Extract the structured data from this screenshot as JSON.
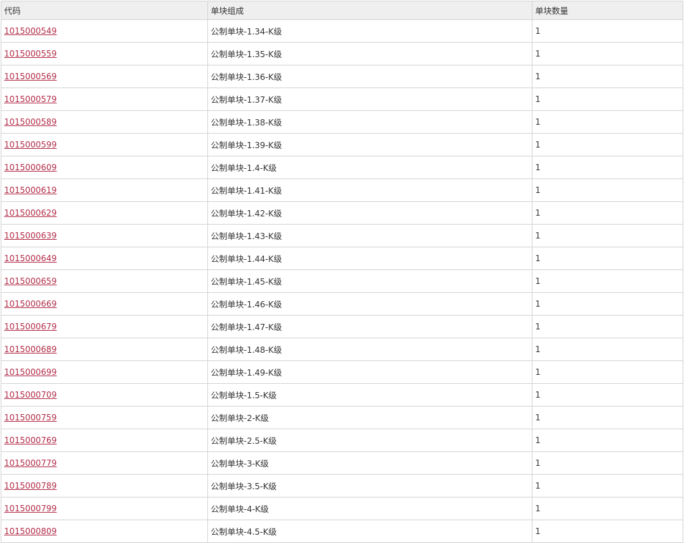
{
  "table": {
    "headers": [
      "代码",
      "单块组成",
      "单块数量"
    ],
    "rows": [
      {
        "code": "1015000549",
        "composition": "公制单块-1.34-K级",
        "quantity": "1"
      },
      {
        "code": "1015000559",
        "composition": "公制单块-1.35-K级",
        "quantity": "1"
      },
      {
        "code": "1015000569",
        "composition": "公制单块-1.36-K级",
        "quantity": "1"
      },
      {
        "code": "1015000579",
        "composition": "公制单块-1.37-K级",
        "quantity": "1"
      },
      {
        "code": "1015000589",
        "composition": "公制单块-1.38-K级",
        "quantity": "1"
      },
      {
        "code": "1015000599",
        "composition": "公制单块-1.39-K级",
        "quantity": "1"
      },
      {
        "code": "1015000609",
        "composition": "公制单块-1.4-K级",
        "quantity": "1"
      },
      {
        "code": "1015000619",
        "composition": "公制单块-1.41-K级",
        "quantity": "1"
      },
      {
        "code": "1015000629",
        "composition": "公制单块-1.42-K级",
        "quantity": "1"
      },
      {
        "code": "1015000639",
        "composition": "公制单块-1.43-K级",
        "quantity": "1"
      },
      {
        "code": "1015000649",
        "composition": "公制单块-1.44-K级",
        "quantity": "1"
      },
      {
        "code": "1015000659",
        "composition": "公制单块-1.45-K级",
        "quantity": "1"
      },
      {
        "code": "1015000669",
        "composition": "公制单块-1.46-K级",
        "quantity": "1"
      },
      {
        "code": "1015000679",
        "composition": "公制单块-1.47-K级",
        "quantity": "1"
      },
      {
        "code": "1015000689",
        "composition": "公制单块-1.48-K级",
        "quantity": "1"
      },
      {
        "code": "1015000699",
        "composition": "公制单块-1.49-K级",
        "quantity": "1"
      },
      {
        "code": "1015000709",
        "composition": "公制单块-1.5-K级",
        "quantity": "1"
      },
      {
        "code": "1015000759",
        "composition": "公制单块-2-K级",
        "quantity": "1"
      },
      {
        "code": "1015000769",
        "composition": "公制单块-2.5-K级",
        "quantity": "1"
      },
      {
        "code": "1015000779",
        "composition": "公制单块-3-K级",
        "quantity": "1"
      },
      {
        "code": "1015000789",
        "composition": "公制单块-3.5-K级",
        "quantity": "1"
      },
      {
        "code": "1015000799",
        "composition": "公制单块-4-K级",
        "quantity": "1"
      },
      {
        "code": "1015000809",
        "composition": "公制单块-4.5-K级",
        "quantity": "1"
      }
    ]
  },
  "colors": {
    "link": "#b22c47",
    "header_bg": "#efefef",
    "border": "#d4d4d4",
    "text": "#333333"
  }
}
